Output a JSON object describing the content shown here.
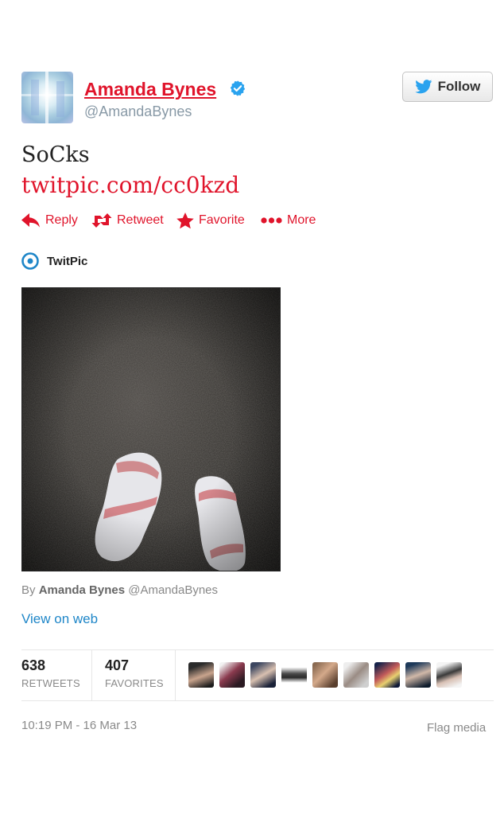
{
  "user": {
    "name": "Amanda Bynes",
    "handle": "@AmandaBynes",
    "follow_label": "Follow"
  },
  "tweet": {
    "text": "SoCks",
    "link": "twitpic.com/cc0kzd"
  },
  "actions": {
    "reply": "Reply",
    "retweet": "Retweet",
    "favorite": "Favorite",
    "more": "More"
  },
  "media": {
    "provider": "TwitPic",
    "by_prefix": "By",
    "by_name": "Amanda Bynes",
    "by_handle": "@AmandaBynes",
    "view_on_web": "View on web",
    "flag": "Flag media"
  },
  "stats": {
    "retweets_count": "638",
    "retweets_label": "RETWEETS",
    "favorites_count": "407",
    "favorites_label": "FAVORITES"
  },
  "timestamp": "10:19 PM - 16 Mar 13",
  "colors": {
    "accent": "#e0142b",
    "link_blue": "#1e86c8",
    "verified": "#2aa3ef",
    "twitter_bird": "#2aa3ef"
  },
  "icons": {
    "verified": "verified-badge-icon",
    "follow": "twitter-bird-icon",
    "reply": "reply-arrow-icon",
    "retweet": "retweet-icon",
    "favorite": "star-icon",
    "more": "more-dots-icon",
    "provider": "twitpic-logo-icon"
  }
}
